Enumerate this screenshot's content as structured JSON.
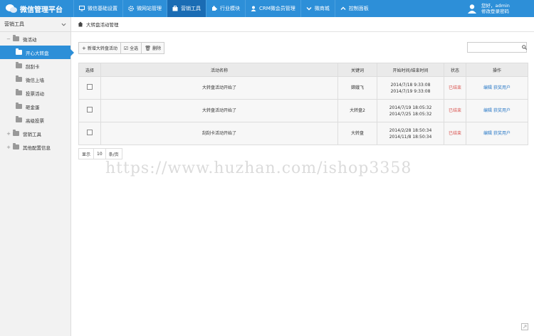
{
  "header": {
    "logo_text": "微信管理平台",
    "nav": [
      {
        "label": "微信基础设置",
        "icon": "monitor-icon",
        "active": false
      },
      {
        "label": "微网站管理",
        "icon": "gear-icon",
        "active": false
      },
      {
        "label": "营销工具",
        "icon": "briefcase-icon",
        "active": true
      },
      {
        "label": "行业模块",
        "icon": "puzzle-icon",
        "active": false
      },
      {
        "label": "CRM微会员管理",
        "icon": "user-icon",
        "active": false
      },
      {
        "label": "微商城",
        "icon": "chevron-down-icon",
        "active": false
      },
      {
        "label": "控制面板",
        "icon": "chevron-up-icon",
        "active": false
      }
    ],
    "user": {
      "greeting": "您好，admin",
      "action": "修改登录密码"
    }
  },
  "sidebar": {
    "title": "营销工具",
    "items": [
      {
        "label": "微活动",
        "toggle": "−",
        "level": 1
      },
      {
        "label": "开心大转盘",
        "level": 2,
        "active": true
      },
      {
        "label": "刮刮卡",
        "level": 2
      },
      {
        "label": "微信上墙",
        "level": 2
      },
      {
        "label": "投票活动",
        "level": 2
      },
      {
        "label": "砸金蛋",
        "level": 2
      },
      {
        "label": "高级投票",
        "level": 2
      },
      {
        "label": "营销工具",
        "toggle": "+",
        "level": 1
      },
      {
        "label": "其他配置信息",
        "toggle": "+",
        "level": 1
      }
    ]
  },
  "breadcrumb": "大转盘活动管理",
  "toolbar": {
    "add": "新增大转盘活动",
    "select_all": "全选",
    "delete": "删除"
  },
  "search": {
    "placeholder": ""
  },
  "table": {
    "headers": [
      "选择",
      "活动名称",
      "关键词",
      "开始时间/结束时间",
      "状态",
      "操作"
    ],
    "rows": [
      {
        "name": "大转盘活动开始了",
        "keyword": "嫦娥飞",
        "start": "2014/7/18 9:33:08",
        "end": "2014/7/19 9:33:08",
        "status": "已结束",
        "edit": "编辑",
        "winners": "获奖用户"
      },
      {
        "name": "大转盘活动开始了",
        "keyword": "大转盘2",
        "start": "2014/7/19 18:05:32",
        "end": "2014/7/25 18:05:32",
        "status": "已结束",
        "edit": "编辑",
        "winners": "获奖用户"
      },
      {
        "name": "刮刮卡活动开始了",
        "keyword": "大转盘",
        "start": "2014/2/28 18:50:34",
        "end": "2014/11/8 18:50:34",
        "status": "已结束",
        "edit": "编辑",
        "winners": "获奖用户"
      }
    ]
  },
  "pager": {
    "show": "显示",
    "size": "10",
    "unit": "条/页"
  },
  "watermark": "https://www.huzhan.com/ishop3358",
  "colors": {
    "primary": "#2d8fd8",
    "status": "#d9534f",
    "link": "#2d7bc7"
  }
}
